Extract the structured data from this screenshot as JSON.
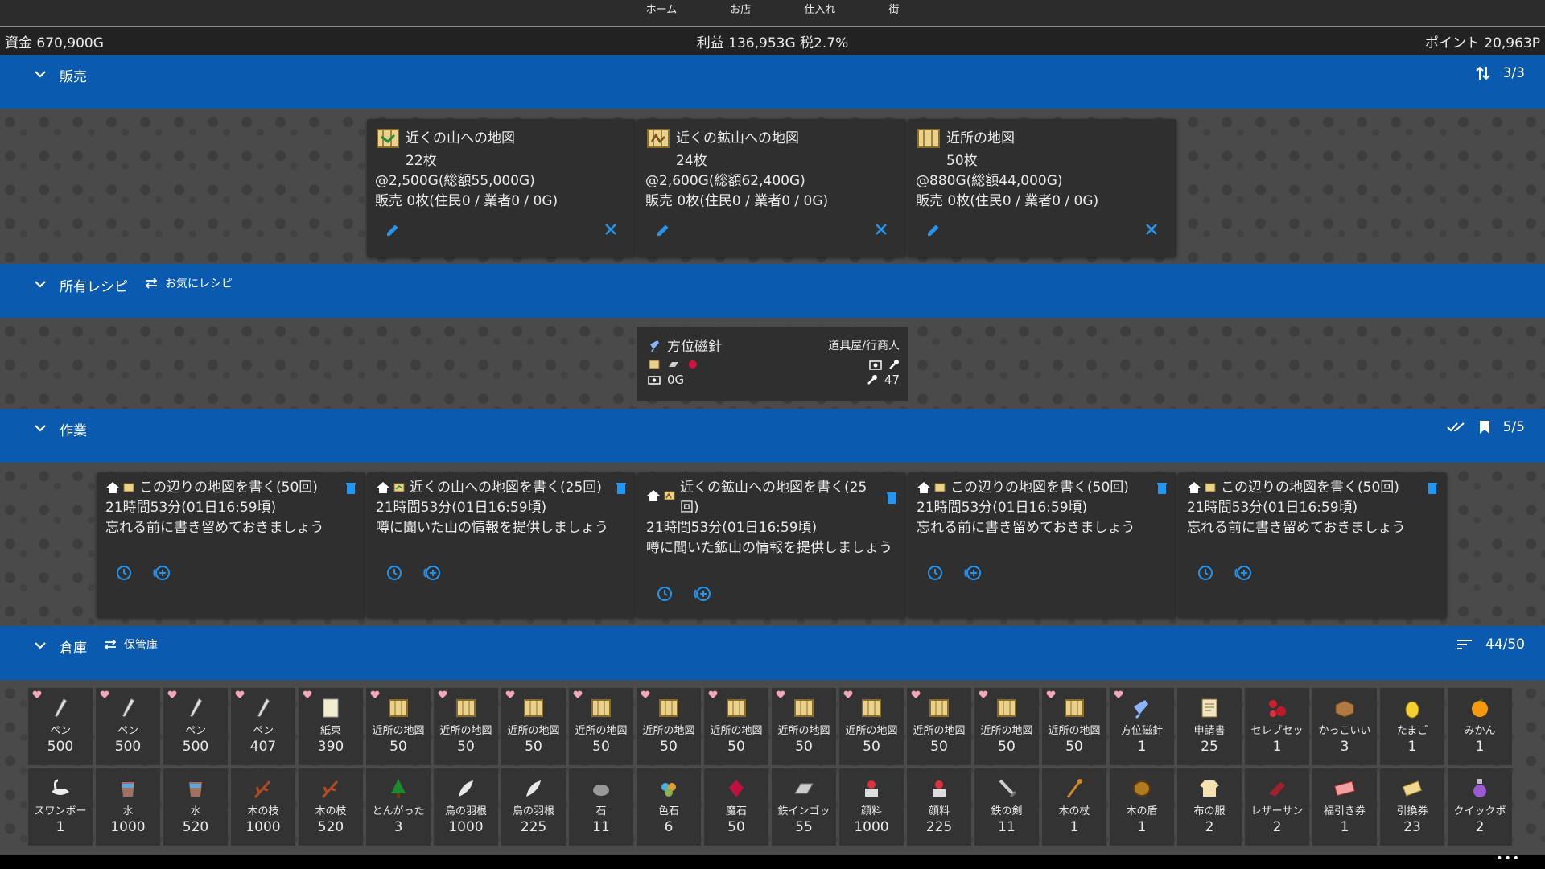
{
  "nav": {
    "items": [
      "ホーム",
      "お店",
      "仕入れ",
      "街"
    ]
  },
  "status": {
    "funds": "資金 670,900G",
    "profit": "利益 136,953G  税2.7%",
    "points": "ポイント 20,963P"
  },
  "colors": {
    "section_bar": "#0a5ab0",
    "background": "#2b2b2b",
    "accent_icon": "#1e90ff",
    "heart": "#f4a6b8"
  },
  "sales": {
    "title": "販売",
    "counter": "3/3",
    "items": [
      {
        "name": "近くの山への地図",
        "count": "22枚",
        "price": "@2,500G(総額55,000G)",
        "sold": "販売 0枚(住民0 / 業者0 / 0G)"
      },
      {
        "name": "近くの鉱山への地図",
        "count": "24枚",
        "price": "@2,600G(総額62,400G)",
        "sold": "販売 0枚(住民0 / 業者0 / 0G)"
      },
      {
        "name": "近所の地図",
        "count": "50枚",
        "price": "@880G(総額44,000G)",
        "sold": "販売 0枚(住民0 / 業者0 / 0G)"
      }
    ]
  },
  "recipes": {
    "title": "所有レシピ",
    "swap_label": "お気にレシピ",
    "card": {
      "name": "方位磁針",
      "shop": "道具屋/行商人",
      "cost": "0G",
      "skill": "47"
    }
  },
  "jobs": {
    "title": "作業",
    "counter": "5/5",
    "items": [
      {
        "title": "この辺りの地図を書く(50回)",
        "time": "21時間53分(01日16:59頃)",
        "desc": "忘れる前に書き留めておきましょう"
      },
      {
        "title": "近くの山への地図を書く(25回)",
        "time": "21時間53分(01日16:59頃)",
        "desc": "噂に聞いた山の情報を提供しましょう"
      },
      {
        "title": "近くの鉱山への地図を書く(25回)",
        "time": "21時間53分(01日16:59頃)",
        "desc": "噂に聞いた鉱山の情報を提供しましょう"
      },
      {
        "title": "この辺りの地図を書く(50回)",
        "time": "21時間53分(01日16:59頃)",
        "desc": "忘れる前に書き留めておきましょう"
      },
      {
        "title": "この辺りの地図を書く(50回)",
        "time": "21時間53分(01日16:59頃)",
        "desc": "忘れる前に書き留めておきましょう"
      }
    ]
  },
  "warehouse": {
    "title": "倉庫",
    "swap_label": "保管庫",
    "counter": "44/50",
    "items": [
      {
        "name": "ペン",
        "count": "500",
        "fav": true,
        "icon": "pen-icon"
      },
      {
        "name": "ペン",
        "count": "500",
        "fav": true,
        "icon": "pen-icon"
      },
      {
        "name": "ペン",
        "count": "500",
        "fav": true,
        "icon": "pen-icon"
      },
      {
        "name": "ペン",
        "count": "407",
        "fav": true,
        "icon": "pen-icon"
      },
      {
        "name": "紙束",
        "count": "390",
        "fav": true,
        "icon": "paper-icon"
      },
      {
        "name": "近所の地図",
        "count": "50",
        "fav": true,
        "icon": "map-icon"
      },
      {
        "name": "近所の地図",
        "count": "50",
        "fav": true,
        "icon": "map-icon"
      },
      {
        "name": "近所の地図",
        "count": "50",
        "fav": true,
        "icon": "map-icon"
      },
      {
        "name": "近所の地図",
        "count": "50",
        "fav": true,
        "icon": "map-icon"
      },
      {
        "name": "近所の地図",
        "count": "50",
        "fav": true,
        "icon": "map-icon"
      },
      {
        "name": "近所の地図",
        "count": "50",
        "fav": true,
        "icon": "map-icon"
      },
      {
        "name": "近所の地図",
        "count": "50",
        "fav": true,
        "icon": "map-icon"
      },
      {
        "name": "近所の地図",
        "count": "50",
        "fav": true,
        "icon": "map-icon"
      },
      {
        "name": "近所の地図",
        "count": "50",
        "fav": true,
        "icon": "map-icon"
      },
      {
        "name": "近所の地図",
        "count": "50",
        "fav": true,
        "icon": "map-icon"
      },
      {
        "name": "近所の地図",
        "count": "50",
        "fav": true,
        "icon": "map-icon"
      },
      {
        "name": "方位磁針",
        "count": "1",
        "fav": true,
        "icon": "compass-icon"
      },
      {
        "name": "申請書",
        "count": "25",
        "fav": false,
        "icon": "document-icon"
      },
      {
        "name": "セレブセッ",
        "count": "1",
        "fav": false,
        "icon": "celeb-set-icon"
      },
      {
        "name": "かっこいい",
        "count": "3",
        "fav": false,
        "icon": "box-icon"
      },
      {
        "name": "たまご",
        "count": "1",
        "fav": false,
        "icon": "egg-icon"
      },
      {
        "name": "みかん",
        "count": "1",
        "fav": false,
        "icon": "orange-icon"
      },
      {
        "name": "スワンボー",
        "count": "1",
        "fav": false,
        "icon": "swan-boat-icon"
      },
      {
        "name": "水",
        "count": "1000",
        "fav": false,
        "icon": "water-icon"
      },
      {
        "name": "水",
        "count": "520",
        "fav": false,
        "icon": "water-icon"
      },
      {
        "name": "木の枝",
        "count": "1000",
        "fav": false,
        "icon": "branch-icon"
      },
      {
        "name": "木の枝",
        "count": "520",
        "fav": false,
        "icon": "branch-icon"
      },
      {
        "name": "とんがった",
        "count": "3",
        "fav": false,
        "icon": "tree-icon"
      },
      {
        "name": "鳥の羽根",
        "count": "1000",
        "fav": false,
        "icon": "feather-icon"
      },
      {
        "name": "鳥の羽根",
        "count": "225",
        "fav": false,
        "icon": "feather-icon"
      },
      {
        "name": "石",
        "count": "11",
        "fav": false,
        "icon": "stone-icon"
      },
      {
        "name": "色石",
        "count": "6",
        "fav": false,
        "icon": "color-stone-icon"
      },
      {
        "name": "魔石",
        "count": "50",
        "fav": false,
        "icon": "magic-stone-icon"
      },
      {
        "name": "鉄インゴッ",
        "count": "55",
        "fav": false,
        "icon": "iron-ingot-icon"
      },
      {
        "name": "顔料",
        "count": "1000",
        "fav": false,
        "icon": "pigment-icon"
      },
      {
        "name": "顔料",
        "count": "225",
        "fav": false,
        "icon": "pigment-icon"
      },
      {
        "name": "鉄の剣",
        "count": "11",
        "fav": false,
        "icon": "sword-icon"
      },
      {
        "name": "木の杖",
        "count": "1",
        "fav": false,
        "icon": "staff-icon"
      },
      {
        "name": "木の盾",
        "count": "1",
        "fav": false,
        "icon": "shield-icon"
      },
      {
        "name": "布の服",
        "count": "2",
        "fav": false,
        "icon": "cloth-icon"
      },
      {
        "name": "レザーサン",
        "count": "2",
        "fav": false,
        "icon": "sandal-icon"
      },
      {
        "name": "福引き券",
        "count": "1",
        "fav": false,
        "icon": "lottery-ticket-icon"
      },
      {
        "name": "引換券",
        "count": "23",
        "fav": false,
        "icon": "voucher-icon"
      },
      {
        "name": "クイックポ",
        "count": "2",
        "fav": false,
        "icon": "potion-icon"
      }
    ]
  }
}
